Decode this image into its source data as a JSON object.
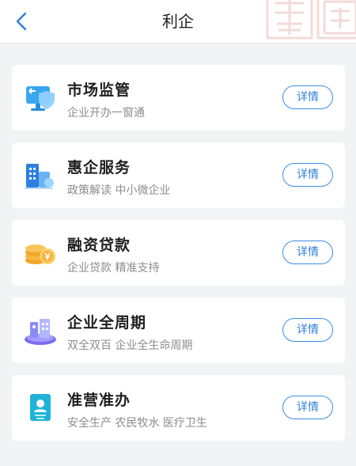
{
  "header": {
    "title": "利企"
  },
  "cards": [
    {
      "title": "市场监管",
      "subtitle": "企业开办一窗通",
      "button": "详情"
    },
    {
      "title": "惠企服务",
      "subtitle": "政策解读 中小微企业",
      "button": "详情"
    },
    {
      "title": "融资贷款",
      "subtitle": "企业贷款 精准支持",
      "button": "详情"
    },
    {
      "title": "企业全周期",
      "subtitle": "双全双百 企业全生命周期",
      "button": "详情"
    },
    {
      "title": "准营准办",
      "subtitle": "安全生产 农民牧水 医疗卫生",
      "button": "详情"
    }
  ],
  "colors": {
    "accent": "#2f80d8",
    "background": "#f2f3f5",
    "card": "#ffffff"
  }
}
